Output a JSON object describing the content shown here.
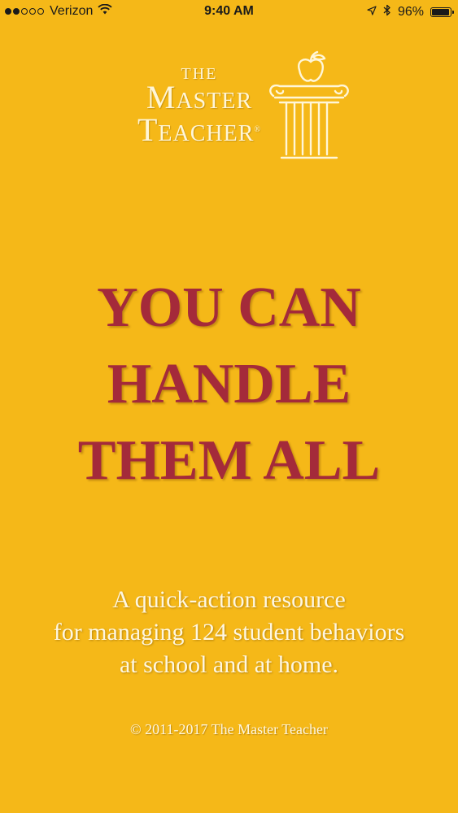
{
  "status_bar": {
    "carrier": "Verizon",
    "signal_bars": 2,
    "signal_total": 5,
    "time": "9:40 AM",
    "battery": "96%",
    "battery_level": 0.96,
    "icons": [
      "wifi-icon",
      "location-arrow-icon",
      "bluetooth-icon",
      "battery-icon"
    ]
  },
  "logo": {
    "line1": "THE",
    "line2": "Master",
    "line3": "Teacher",
    "registered": "®"
  },
  "headline": [
    "YOU CAN",
    "HANDLE",
    "THEM ALL"
  ],
  "subtitle": [
    "A quick-action resource",
    "for managing 124 student behaviors",
    "at school and at home."
  ],
  "copyright": "© 2011-2017 The Master Teacher",
  "colors": {
    "background": "#F5B818",
    "headline": "#A42A3A",
    "light_text": "#FFF7E0"
  }
}
